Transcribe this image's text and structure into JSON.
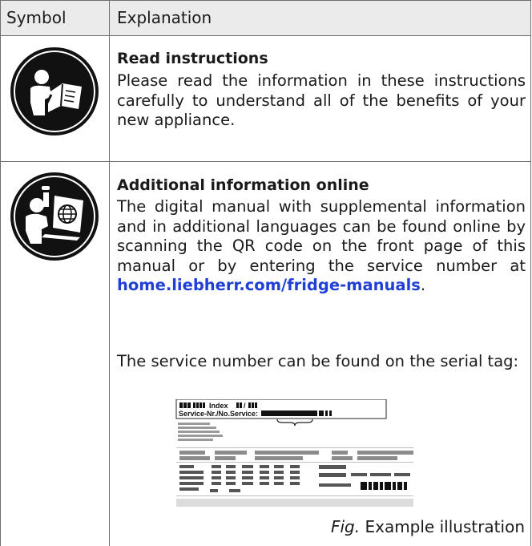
{
  "header": {
    "col1": "Symbol",
    "col2": "Explanation"
  },
  "rows": [
    {
      "icon": "read-instructions-icon",
      "title": "Read instructions",
      "text": "Please read the information in these instructions carefully to understand all of the benefits of your new appliance."
    },
    {
      "icon": "online-information-icon",
      "title": "Additional information online",
      "text_before_link": "The digital manual with supplemental information and in additional languages can be found online by scanning the QR code on the front page of this manual or by entering the service number at ",
      "link": "home.liebherr.com/fridge-manuals",
      "text_after_link": ".",
      "text2": "The service number can be found on the serial tag:"
    }
  ],
  "serial_tag": {
    "index_label": "Index",
    "service_label": "Service-Nr./No.Service:"
  },
  "caption": {
    "fig": "Fig.",
    "text": " Example illustration"
  },
  "colors": {
    "line": "#6e6e6e",
    "header_bg": "#ebebeb",
    "link": "#1f3fd6"
  }
}
